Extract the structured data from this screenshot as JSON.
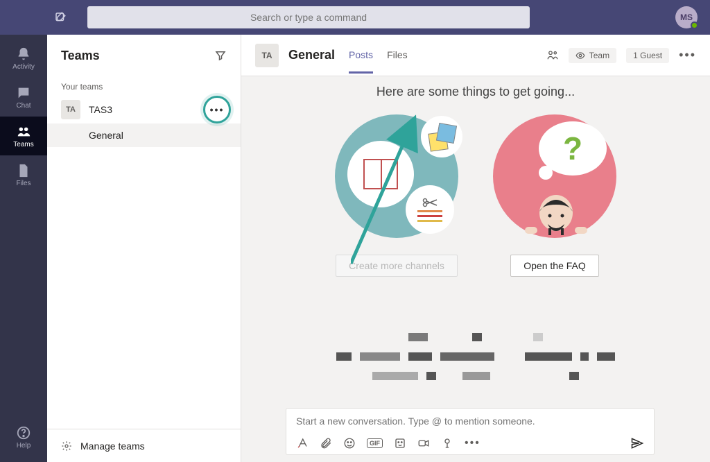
{
  "topbar": {
    "search_placeholder": "Search or type a command",
    "avatar_initials": "MS"
  },
  "rail": {
    "items": [
      {
        "label": "Activity"
      },
      {
        "label": "Chat"
      },
      {
        "label": "Teams"
      },
      {
        "label": "Files"
      }
    ],
    "help_label": "Help"
  },
  "left_panel": {
    "title": "Teams",
    "section_label": "Your teams",
    "team_avatar": "TA",
    "team_name": "TAS3",
    "channel_name": "General",
    "manage_label": "Manage teams"
  },
  "main_header": {
    "avatar": "TA",
    "title": "General",
    "tabs": [
      "Posts",
      "Files"
    ],
    "team_pill": "Team",
    "guest_pill": "1 Guest"
  },
  "content": {
    "intro": "Here are some things to get going...",
    "create_channels_btn": "Create more channels",
    "open_faq_btn": "Open the FAQ"
  },
  "compose": {
    "placeholder": "Start a new conversation. Type @ to mention someone.",
    "gif_label": "GIF"
  }
}
